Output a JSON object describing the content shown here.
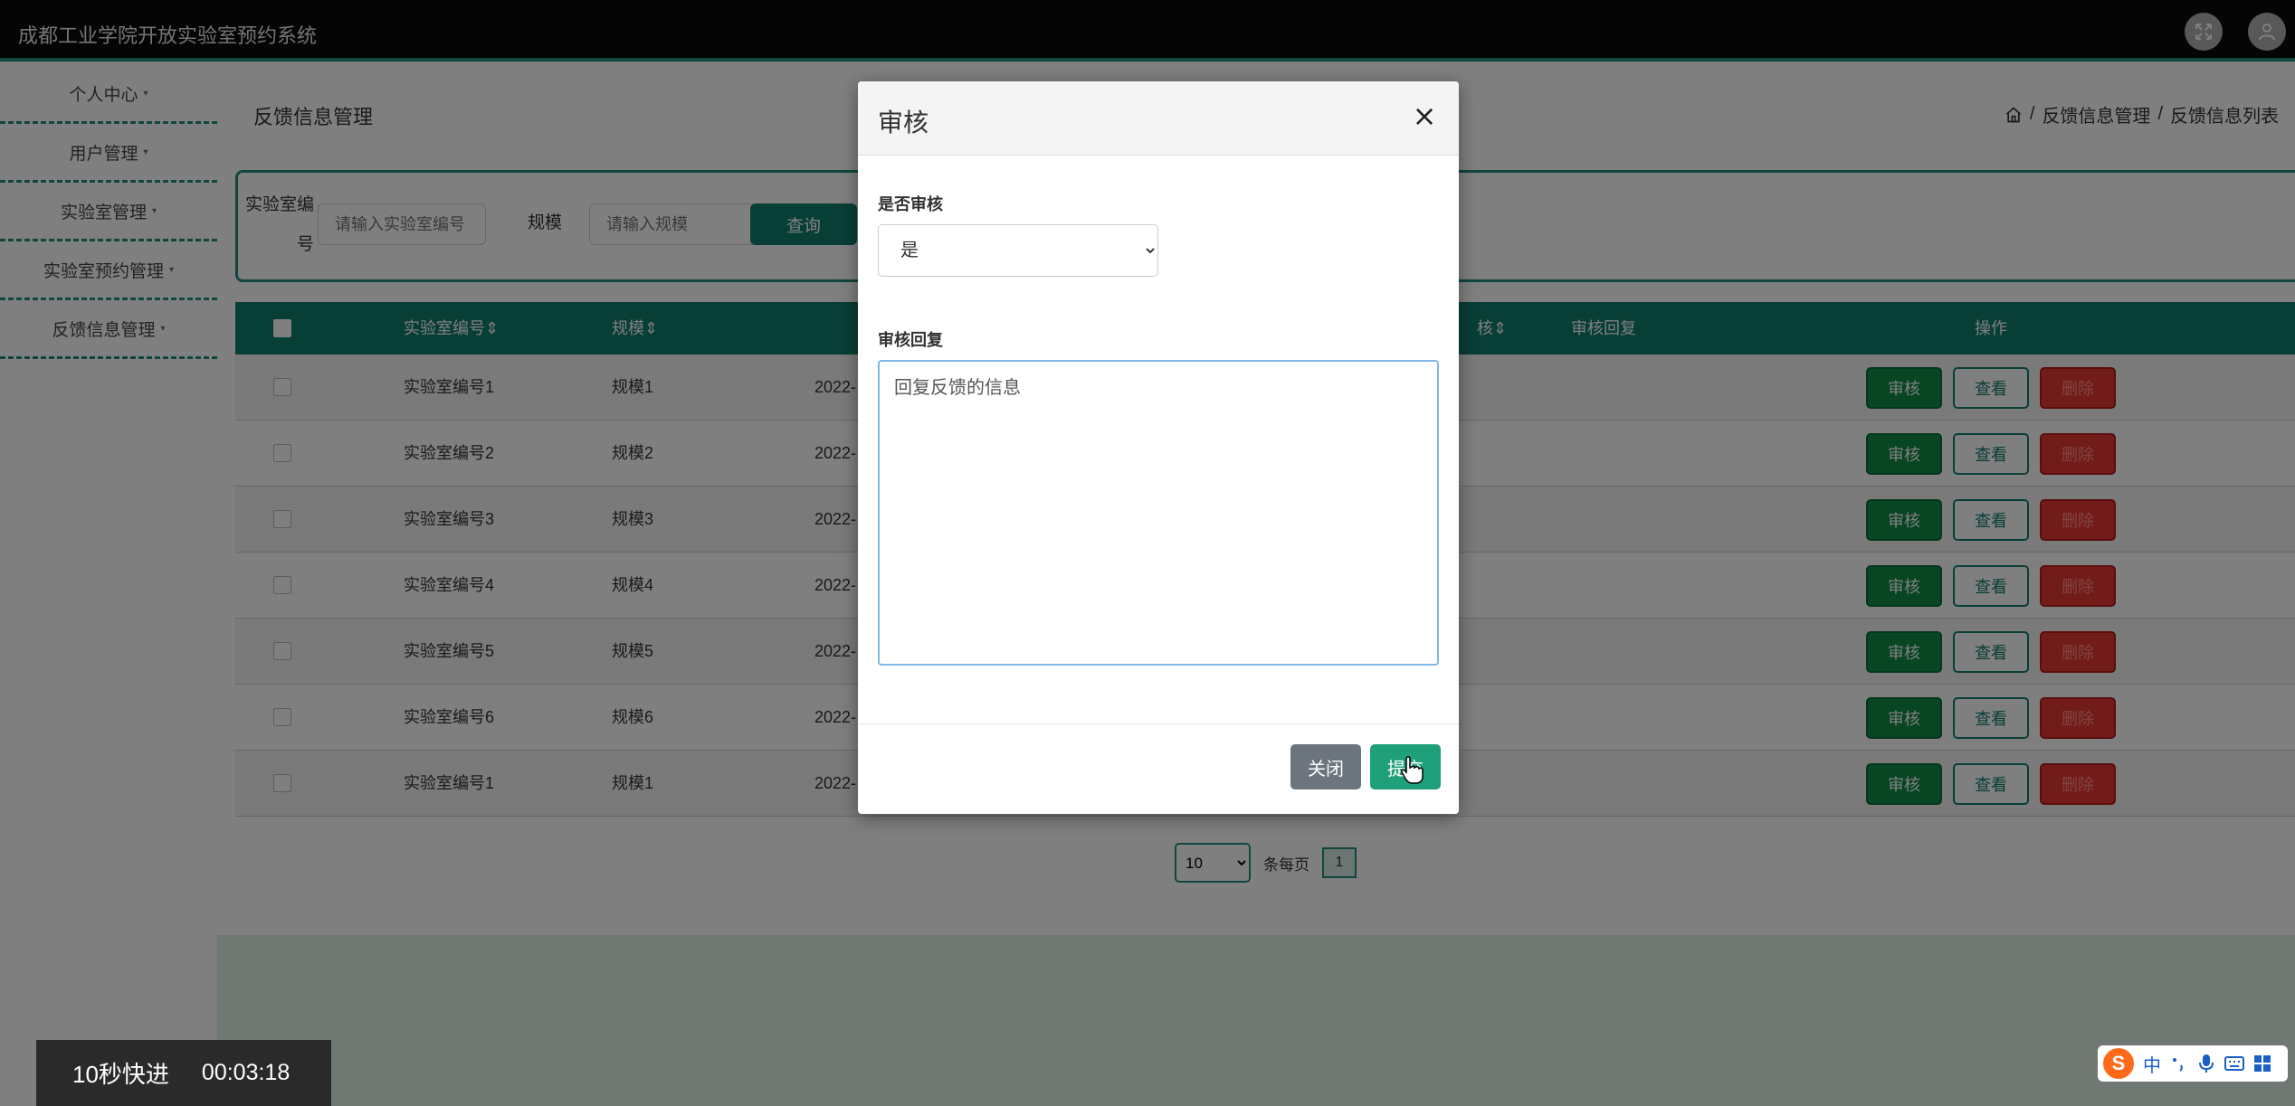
{
  "app": {
    "title": "成都工业学院开放实验室预约系统"
  },
  "sidebar": {
    "items": [
      {
        "label": "个人中心"
      },
      {
        "label": "用户管理"
      },
      {
        "label": "实验室管理"
      },
      {
        "label": "实验室预约管理"
      },
      {
        "label": "反馈信息管理"
      }
    ],
    "caret": "▾"
  },
  "page": {
    "title": "反馈信息管理",
    "breadcrumb": [
      "反馈信息管理",
      "反馈信息列表"
    ],
    "breadcrumb_sep": "/"
  },
  "search": {
    "lab_label": "实验室编号",
    "lab_placeholder": "请输入实验室编号",
    "scale_label": "规模",
    "scale_placeholder": "请输入规模",
    "query_label": "查询"
  },
  "table": {
    "headers": {
      "lab": "实验室编号",
      "scale": "规模",
      "status_tail": "核",
      "reply": "审核回复",
      "ops": "操作"
    },
    "sort_icon": "⇕",
    "rows": [
      {
        "lab": "实验室编号1",
        "scale": "规模1",
        "date": "2022-"
      },
      {
        "lab": "实验室编号2",
        "scale": "规模2",
        "date": "2022-"
      },
      {
        "lab": "实验室编号3",
        "scale": "规模3",
        "date": "2022-"
      },
      {
        "lab": "实验室编号4",
        "scale": "规模4",
        "date": "2022-"
      },
      {
        "lab": "实验室编号5",
        "scale": "规模5",
        "date": "2022-"
      },
      {
        "lab": "实验室编号6",
        "scale": "规模6",
        "date": "2022-"
      },
      {
        "lab": "实验室编号1",
        "scale": "规模1",
        "date": "2022-"
      }
    ],
    "op_labels": {
      "approve": "审核",
      "view": "查看",
      "delete": "删除"
    }
  },
  "pager": {
    "page_size": "10",
    "per_page_label": "条每页",
    "current_page": "1"
  },
  "modal": {
    "title": "审核",
    "close_x": "×",
    "approve_label": "是否审核",
    "approve_value": "是",
    "reply_label": "审核回复",
    "reply_value": "回复反馈的信息",
    "close_button": "关闭",
    "submit_button": "提交"
  },
  "video": {
    "fast_forward": "10秒快进",
    "time": "00:03:18"
  },
  "ime": {
    "logo": "S",
    "mode": "中"
  },
  "colors": {
    "accent": "#0f7d6c",
    "topbar": "#0b0b0b",
    "approve": "#0e8a46",
    "delete": "#e53935"
  }
}
